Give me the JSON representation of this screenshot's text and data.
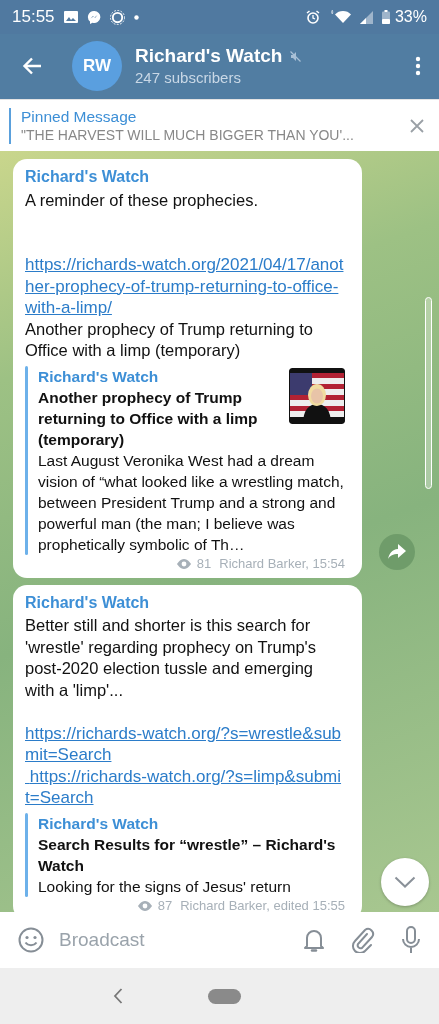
{
  "status_bar": {
    "time": "15:55",
    "battery": "33%"
  },
  "header": {
    "avatar": "RW",
    "title": "Richard's Watch",
    "muted": true,
    "subtitle": "247 subscribers"
  },
  "pinned": {
    "label": "Pinned Message",
    "text": "\"THE HARVEST WILL MUCH BIGGER THAN YOU'..."
  },
  "messages": [
    {
      "sender": "Richard's Watch",
      "text": "A reminder of these prophecies.\n\n\n",
      "links": [
        "https://richards-watch.org/2021/04/17/another-prophecy-of-trump-returning-to-office-with-a-limp/"
      ],
      "after": "Another prophecy of Trump returning to Office with a limp (temporary)",
      "preview": {
        "site": "Richard's Watch",
        "title": "Another prophecy of Trump returning to Office with a limp (temporary)",
        "description": "Last August Veronika West had a dream vision of “what looked like a wrestling match, between President Trump and a strong and powerful man (the man; I believe was prophetically symbolic of Th…",
        "thumbnail": true
      },
      "views": "81",
      "footer": "Richard Barker, 15:54",
      "share_button": true
    },
    {
      "sender": "Richard's Watch",
      "text": "Better still and shorter is this search for 'wrestle' regarding prophecy on Trump's post-2020 election tussle and emerging with a  'limp'...\n\n",
      "links": [
        "https://richards-watch.org/?s=wrestle&submit=Search",
        " https://richards-watch.org/?s=limp&submit=Search"
      ],
      "preview": {
        "site": "Richard's Watch",
        "title": "Search Results for “wrestle” – Richard's Watch",
        "description": "Looking for the signs of Jesus' return",
        "thumbnail": false
      },
      "views": "87",
      "footer": "Richard Barker, edited 15:55",
      "share_button": false
    }
  ],
  "composer": {
    "placeholder": "Broadcast"
  }
}
